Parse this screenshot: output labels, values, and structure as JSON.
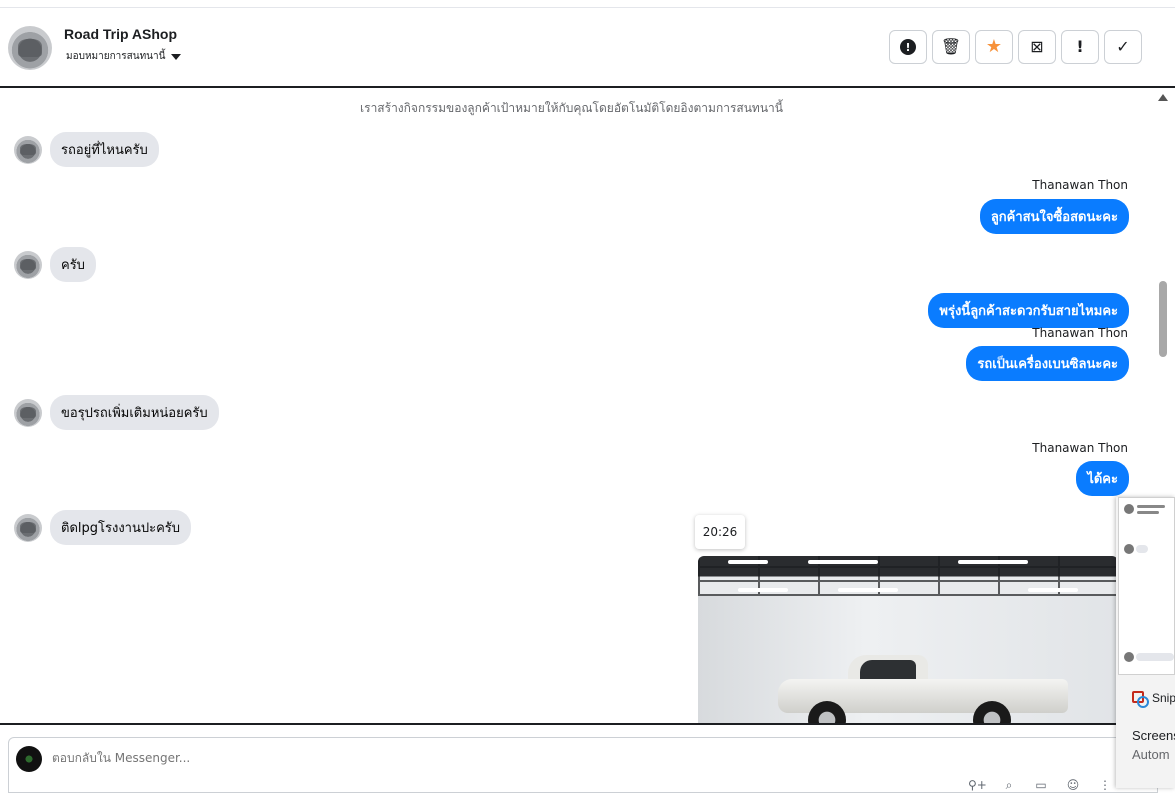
{
  "header": {
    "title": "Road Trip AShop",
    "assign_label": "มอบหมายการสนทนานี้",
    "actions": [
      {
        "icon": "exclamation-circle-icon",
        "glyph": "!"
      },
      {
        "icon": "trash-icon",
        "glyph": "🗑"
      },
      {
        "icon": "star-icon",
        "glyph": "★"
      },
      {
        "icon": "archive-icon",
        "glyph": "⊠"
      },
      {
        "icon": "exclamation-icon",
        "glyph": "!"
      },
      {
        "icon": "check-icon",
        "glyph": "✓"
      }
    ],
    "accent_star": "#f7923b"
  },
  "conversation": {
    "notice": "เราสร้างกิจกรรมของลูกค้าเป้าหมายให้กับคุณโดยอัตโนมัติโดยอิงตามการสนทนานี้",
    "messages": [
      {
        "side": "in",
        "text": "รถอยู่ที่ไหนครับ"
      },
      {
        "side": "out",
        "sender": "Thanawan Thon",
        "text": "ลูกค้าสนใจซื้อสดนะคะ"
      },
      {
        "side": "in",
        "text": "ครับ"
      },
      {
        "side": "out",
        "text": "พรุ่งนี้ลูกค้าสะดวกรับสายไหมคะ"
      },
      {
        "side": "out",
        "sender": "Thanawan Thon",
        "text": "รถเป็นเครื่องเบนซิลนะคะ"
      },
      {
        "side": "in",
        "text": "ขอรุปรถเพิ่มเติมหน่อยครับ"
      },
      {
        "side": "out",
        "sender": "Thanawan Thon",
        "text": "ได้คะ"
      },
      {
        "side": "in",
        "text": "ติดlpgโรงงานปะครับ"
      }
    ],
    "tooltip_time": "20:26",
    "outgoing_color": "#0a7cff",
    "incoming_color": "#e4e6eb"
  },
  "composer": {
    "placeholder": "ตอบกลับใน Messenger...",
    "tools": [
      "add-person-icon",
      "attach-icon",
      "template-icon",
      "emoji-icon",
      "more-icon"
    ]
  },
  "snip_notification": {
    "app": "Snip",
    "title": "Screens",
    "subtitle": "Autom"
  }
}
